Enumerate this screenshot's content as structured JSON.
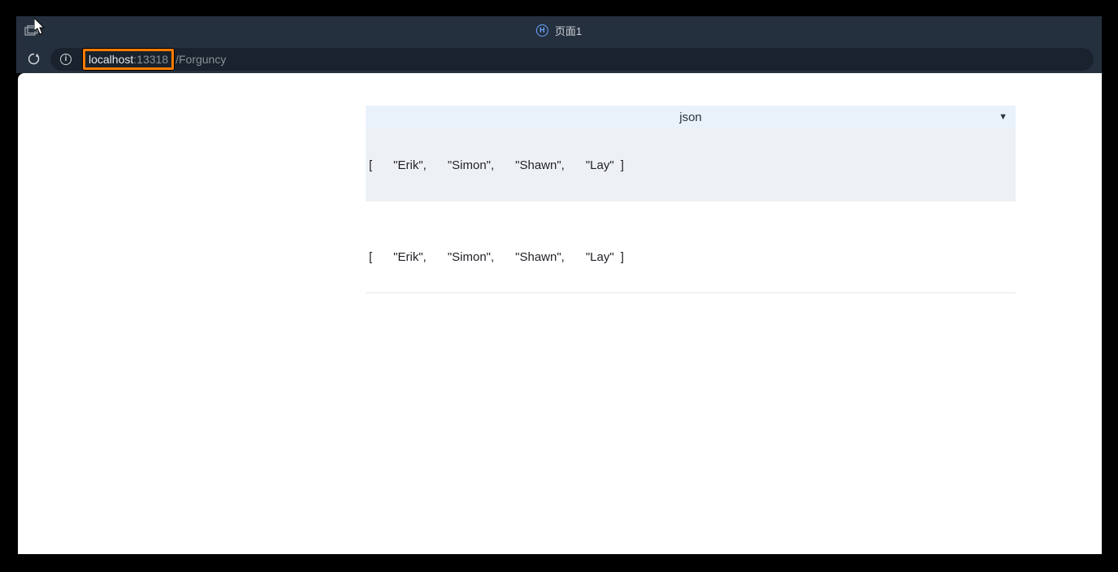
{
  "tab": {
    "title": "页面1",
    "favicon_letter": "H"
  },
  "address": {
    "host": "localhost",
    "port": ":13318",
    "path": "/Forguncy"
  },
  "dropdown": {
    "label": "json"
  },
  "json_array": [
    "Erik",
    "Simon",
    "Shawn",
    "Lay"
  ],
  "json_array2": [
    "Erik",
    "Simon",
    "Shawn",
    "Lay"
  ]
}
